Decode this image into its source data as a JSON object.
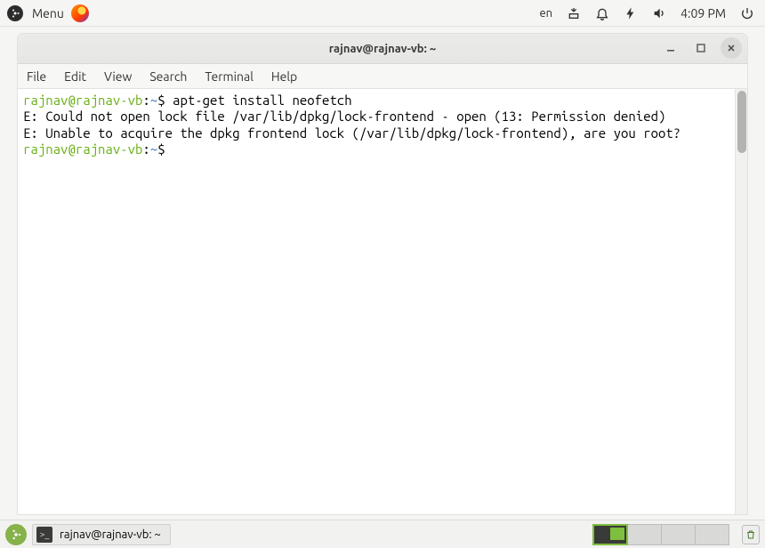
{
  "panel": {
    "menu_label": "Menu",
    "lang": "en",
    "time": "4:09 PM"
  },
  "window": {
    "title": "rajnav@rajnav-vb: ~"
  },
  "menubar": {
    "file": "File",
    "edit": "Edit",
    "view": "View",
    "search": "Search",
    "terminal": "Terminal",
    "help": "Help"
  },
  "terminal": {
    "user": "rajnav",
    "host": "rajnav-vb",
    "path": "~",
    "sep_userhost": "@",
    "sep_hostpath": ":",
    "prompt_char": "$",
    "cmd1": "apt-get install neofetch",
    "out1": "E: Could not open lock file /var/lib/dpkg/lock-frontend - open (13: Permission denied)",
    "out2": "E: Unable to acquire the dpkg frontend lock (/var/lib/dpkg/lock-frontend), are you root?"
  },
  "taskbar": {
    "item1": "rajnav@rajnav-vb: ~"
  }
}
